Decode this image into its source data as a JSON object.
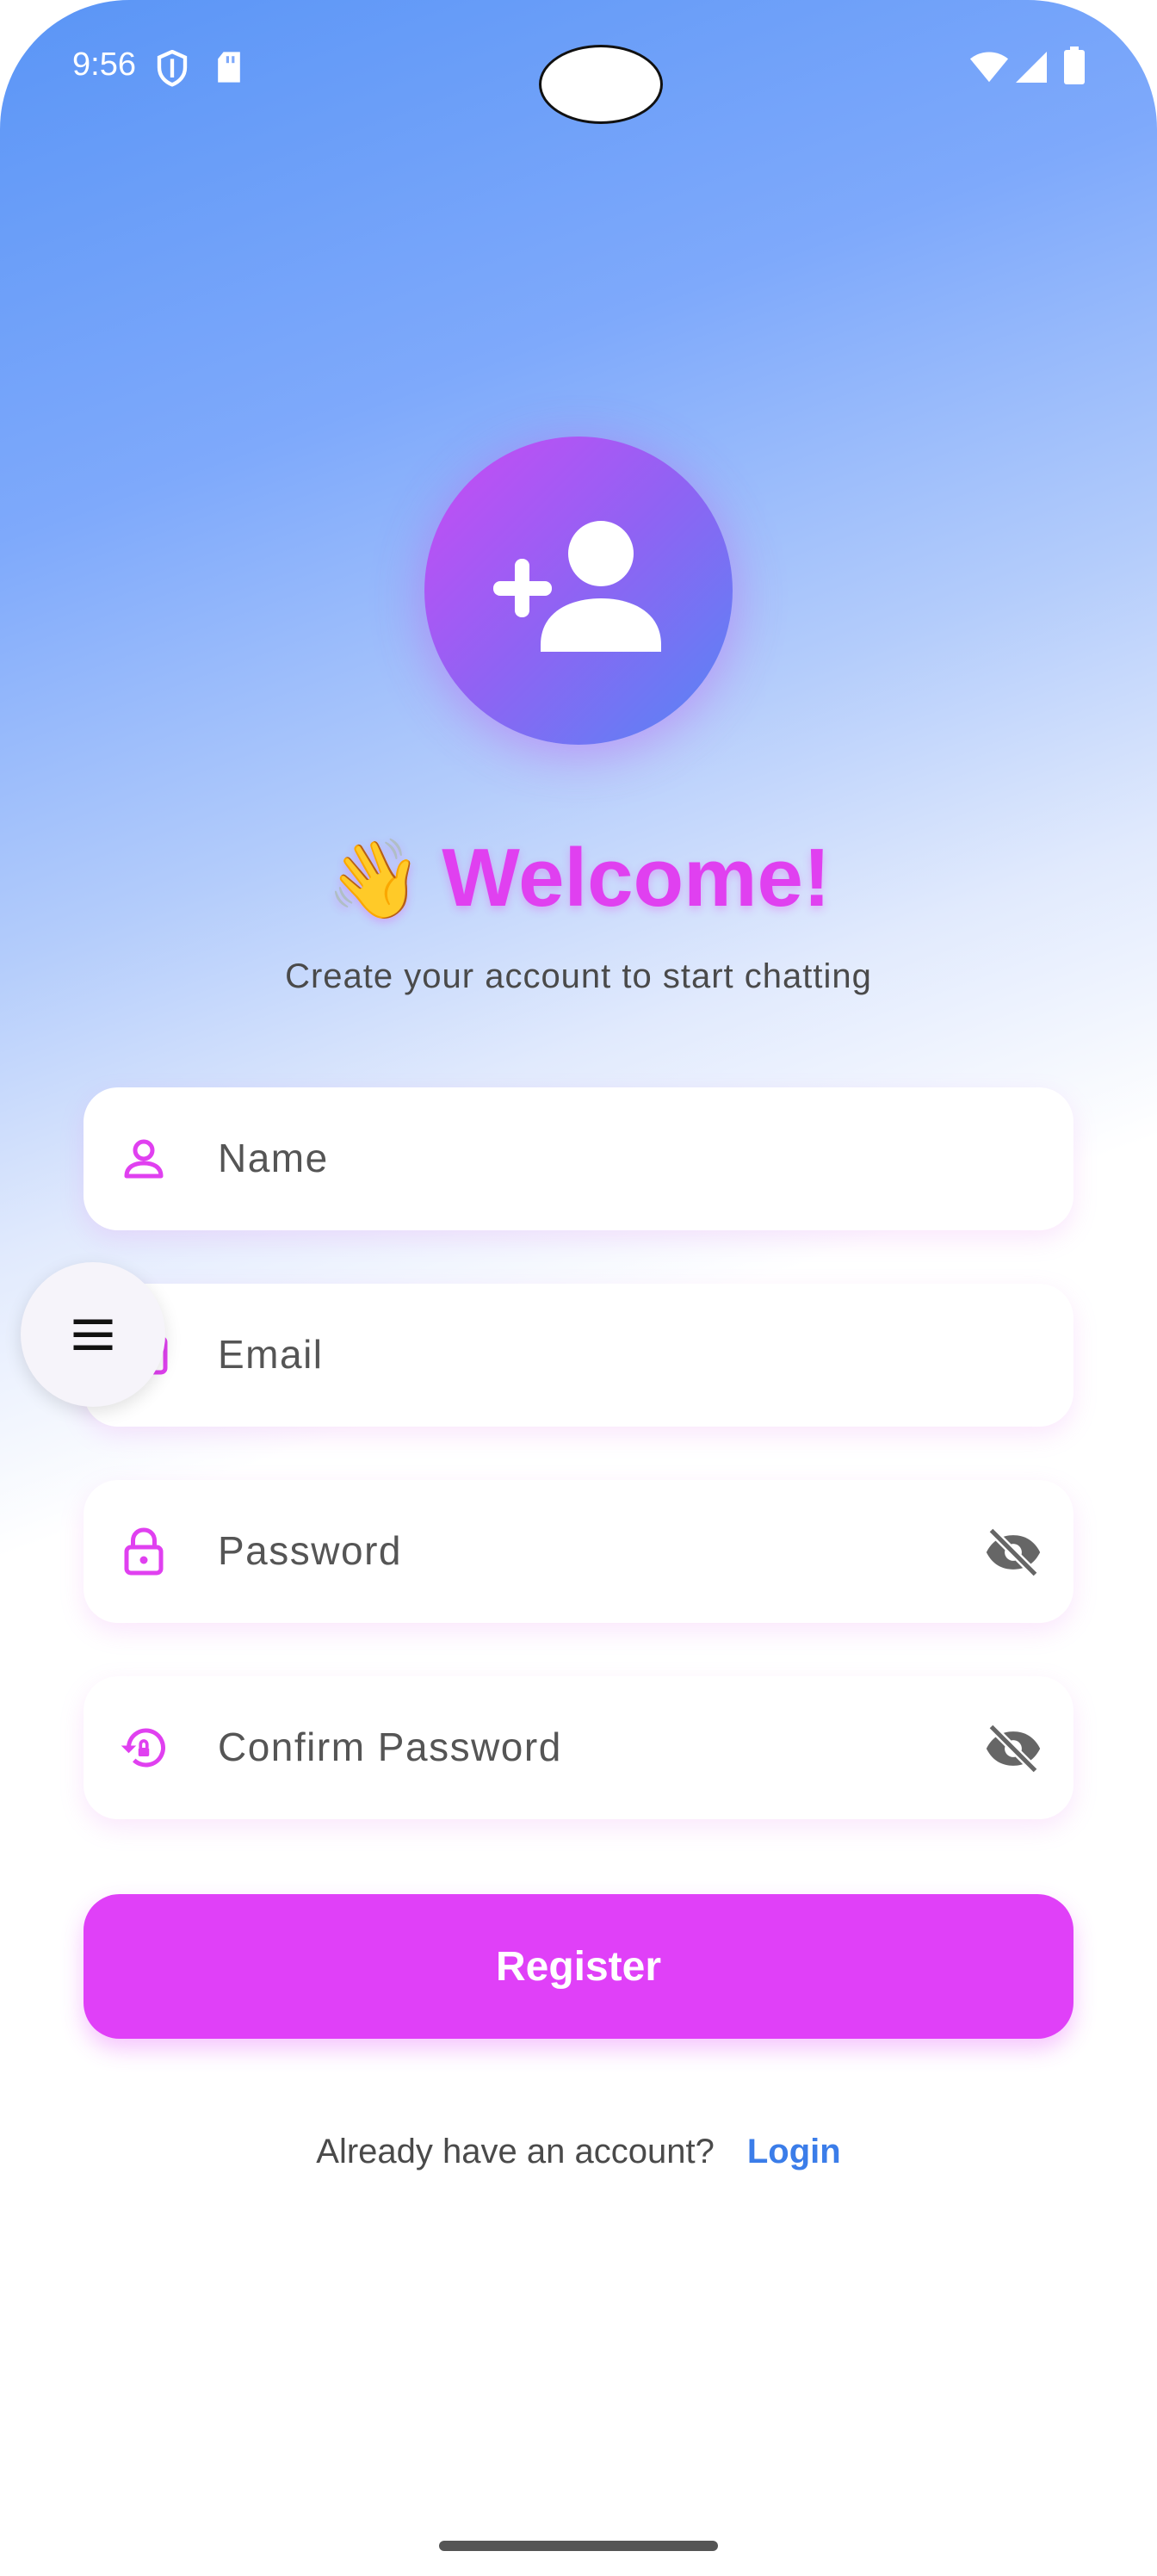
{
  "status_bar": {
    "time": "9:56",
    "icons": [
      "shield-icon",
      "sd-card-icon",
      "wifi-icon",
      "signal-icon",
      "battery-icon"
    ]
  },
  "header": {
    "avatar_icon": "person-add-icon",
    "wave_emoji": "👋",
    "title": "Welcome!",
    "subtitle": "Create your account to start chatting"
  },
  "form": {
    "name_placeholder": "Name",
    "email_placeholder": "Email",
    "password_placeholder": "Password",
    "confirm_password_placeholder": "Confirm Password",
    "register_label": "Register"
  },
  "footer": {
    "prompt": "Already have an account?",
    "login_label": "Login"
  },
  "colors": {
    "accent": "#e040f8",
    "link": "#3b7de9",
    "gradient_top": "#5a95f6"
  },
  "fab_icon": "menu-icon"
}
